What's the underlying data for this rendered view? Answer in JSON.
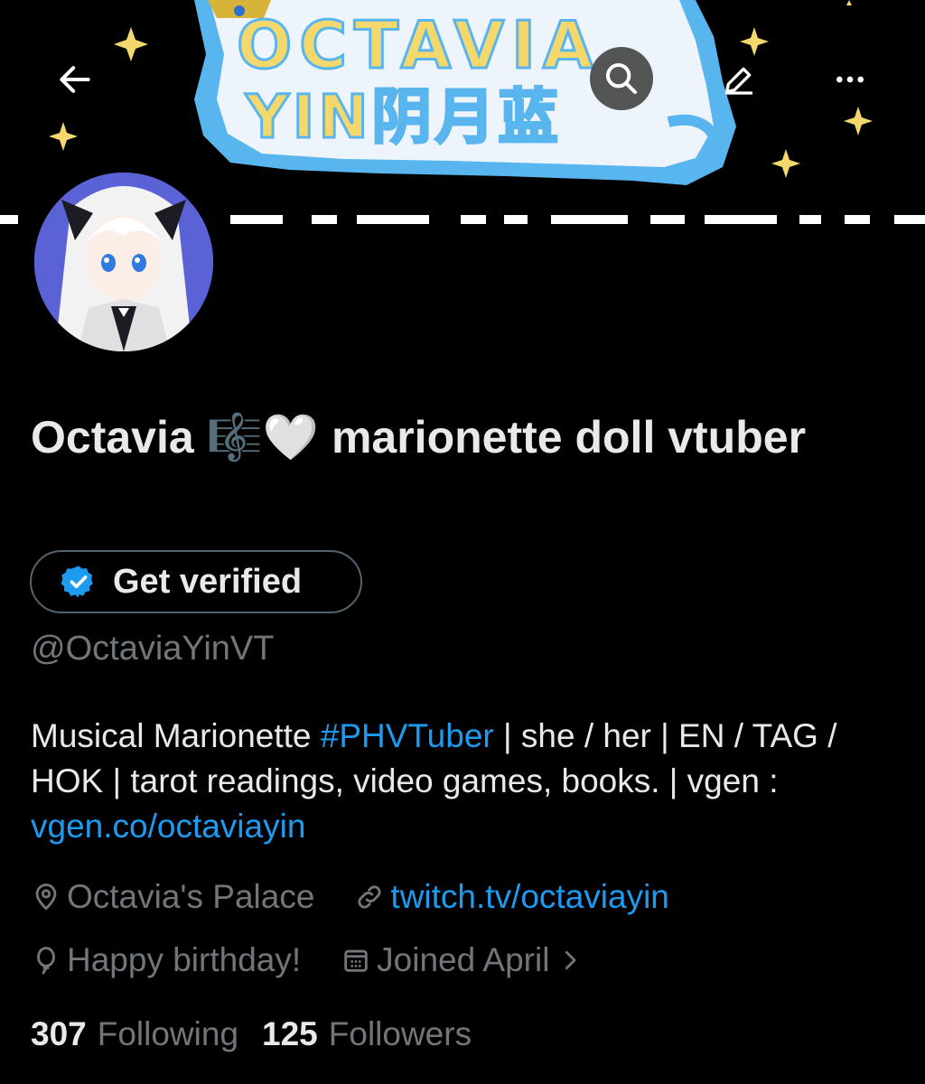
{
  "banner": {
    "title_line1": "OCTAVIA",
    "title_line2": "YIN阴月蓝",
    "title_color": "#f5d86b",
    "outline_color": "#59b5ee"
  },
  "header": {
    "back_icon": "arrow-left-icon",
    "search_icon": "search-icon",
    "edit_icon": "pencil-icon",
    "more_icon": "more-horizontal-icon"
  },
  "profile": {
    "display_name": "Octavia 🎼🤍 marionette doll vtuber",
    "verify_label": "Get verified",
    "handle": "@OctaviaYinVT",
    "bio": {
      "part1": "Musical Marionette ",
      "hashtag": "#PHVTuber",
      "part2": " | she / her | EN / TAG / HOK | tarot readings, video games, books. | vgen : ",
      "link": "vgen.co/octaviayin"
    },
    "location": "Octavia's Palace",
    "website": "twitch.tv/octaviayin",
    "birthday": "Happy birthday!",
    "joined": "Joined April",
    "following_count": "307",
    "following_label": "Following",
    "followers_count": "125",
    "followers_label": "Followers"
  },
  "colors": {
    "accent": "#1d9bf0",
    "muted": "#71767b",
    "text": "#e7e9ea",
    "avatar_bg": "#5b62d6"
  }
}
